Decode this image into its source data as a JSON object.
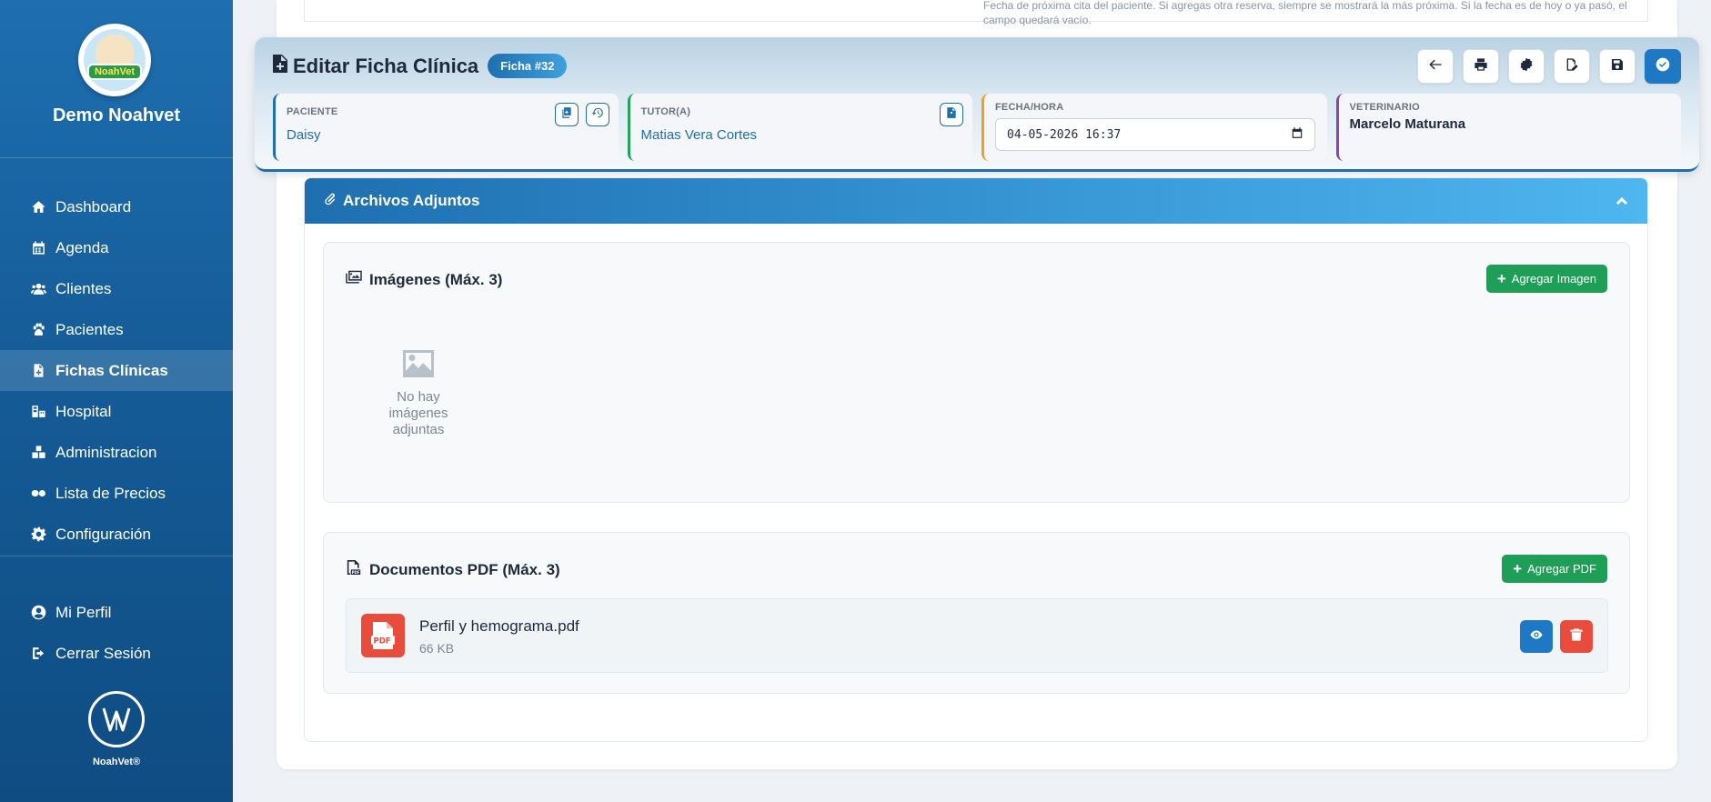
{
  "sidebar": {
    "clinic_name": "Demo Noahvet",
    "logo_text": "NoahVet",
    "nav": [
      {
        "label": "Dashboard",
        "icon": "home-icon"
      },
      {
        "label": "Agenda",
        "icon": "calendar-icon"
      },
      {
        "label": "Clientes",
        "icon": "users-icon"
      },
      {
        "label": "Pacientes",
        "icon": "paw-icon"
      },
      {
        "label": "Fichas Clínicas",
        "icon": "file-medical-icon",
        "active": true
      },
      {
        "label": "Hospital",
        "icon": "hospital-icon"
      },
      {
        "label": "Administracion",
        "icon": "boxes-icon"
      },
      {
        "label": "Lista de Precios",
        "icon": "pills-icon"
      },
      {
        "label": "Configuración",
        "icon": "gear-icon"
      }
    ],
    "bottom_nav": [
      {
        "label": "Mi Perfil",
        "icon": "user-circle-icon"
      },
      {
        "label": "Cerrar Sesión",
        "icon": "logout-icon"
      }
    ],
    "brand_footer": "NoahVet®"
  },
  "top_note": "Fecha de próxima cita del paciente. Si agregas otra reserva, siempre se mostrará la más próxima. Si la fecha es de hoy o ya pasó, el campo quedará vacío.",
  "header": {
    "title": "Editar Ficha Clínica",
    "badge": "Ficha #32",
    "actions": [
      "back-icon",
      "print-icon",
      "certificate-icon",
      "signature-icon",
      "save-icon",
      "check-icon"
    ],
    "cards": {
      "paciente": {
        "label": "PACIENTE",
        "value": "Daisy"
      },
      "tutor": {
        "label": "TUTOR(A)",
        "value": "Matias Vera Cortes"
      },
      "fecha": {
        "label": "FECHA/HORA",
        "value": "04-05-2026 16:37"
      },
      "veterinario": {
        "label": "VETERINARIO",
        "value": "Marcelo Maturana"
      }
    },
    "colors": {
      "paciente": "#1e6fb0",
      "tutor": "#22a559",
      "fecha": "#f0a020",
      "veterinario": "#8e44ad"
    }
  },
  "attachments": {
    "title": "Archivos Adjuntos",
    "images": {
      "title": "Imágenes (Máx. 3)",
      "add_label": "Agregar Imagen",
      "empty_text": "No hay imágenes adjuntas"
    },
    "pdfs": {
      "title": "Documentos PDF (Máx. 3)",
      "add_label": "Agregar PDF",
      "files": [
        {
          "name": "Perfil y hemograma.pdf",
          "size": "66 KB"
        }
      ]
    }
  }
}
